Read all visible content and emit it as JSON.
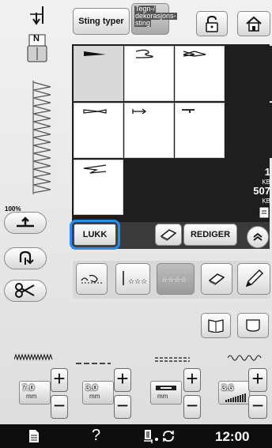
{
  "header": {
    "stitch_types_label": "Sting typer",
    "category_line1": "Tegn-/",
    "category_line2": "dekorasjons-",
    "category_line3": "sting",
    "lock_icon": "padlock-icon",
    "home_icon": "home-icon"
  },
  "presser_foot_label": "N",
  "zoom_label": "100%",
  "memory": {
    "line1_value": "1",
    "line1_unit": "KB",
    "line2_value": "507",
    "line2_unit": "KB"
  },
  "buttons": {
    "close_label": "LUKK",
    "edit_label": "REDIGER"
  },
  "settings": {
    "width_value": "7.0",
    "width_unit": "mm",
    "length_value": "3.0",
    "length_unit": "mm",
    "tension_unit": "mm",
    "density_value": "3.6"
  },
  "status": {
    "help_label": "?",
    "time": "12:00"
  },
  "colors": {
    "highlight": "#1e90ff",
    "grid_background": "#1e1e1e"
  }
}
